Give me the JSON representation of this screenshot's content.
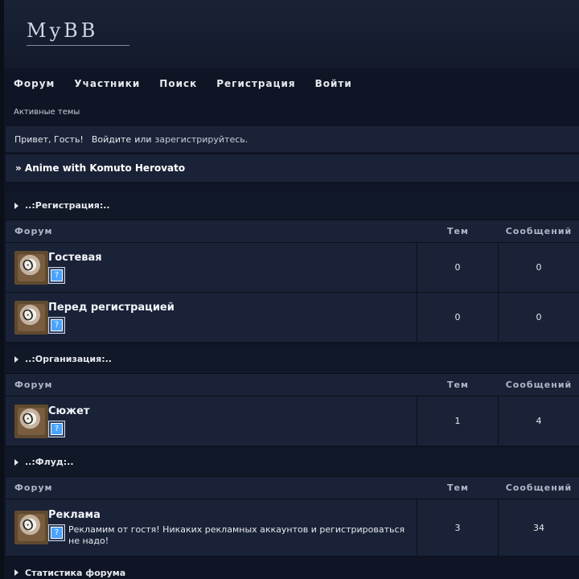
{
  "site": {
    "logo_text": "MyBB",
    "nav": [
      "Форум",
      "Участники",
      "Поиск",
      "Регистрация",
      "Войти"
    ],
    "active_topics": "Активные темы",
    "welcome": {
      "greeting": "Привет, Гость!",
      "prompt_prefix": "Войдите",
      "prompt_mid": "или",
      "prompt_link": "зарегистрируйтесь."
    },
    "forum_header": "» Anime with Komuto Herovato"
  },
  "categories": [
    {
      "title": "..:Регистрация:..",
      "columns": [
        "Форум",
        "Тем",
        "Сообщений"
      ],
      "forums": [
        {
          "name": "Гостевая",
          "description": "",
          "topics": "0",
          "posts": "0"
        },
        {
          "name": "Перед регистрацией",
          "description": "",
          "topics": "0",
          "posts": "0"
        }
      ]
    },
    {
      "title": "..:Организация:..",
      "columns": [
        "Форум",
        "Тем",
        "Сообщений"
      ],
      "forums": [
        {
          "name": "Сюжет",
          "description": "",
          "topics": "1",
          "posts": "4"
        }
      ]
    },
    {
      "title": "..:Флуд:..",
      "columns": [
        "Форум",
        "Тем",
        "Сообщений"
      ],
      "forums": [
        {
          "name": "Реклама",
          "description": "Рекламим от гостя! Никаких рекламных аккаунтов и регистрироваться не надо!",
          "topics": "3",
          "posts": "34"
        }
      ]
    }
  ],
  "stats": {
    "title": "Статистика форума"
  },
  "colors": {
    "page_bg": "#0f1524",
    "header_band": "#1a2237",
    "row_bg": "#1a2237",
    "text": "#e6e9ef",
    "muted": "#aeb7c8"
  }
}
